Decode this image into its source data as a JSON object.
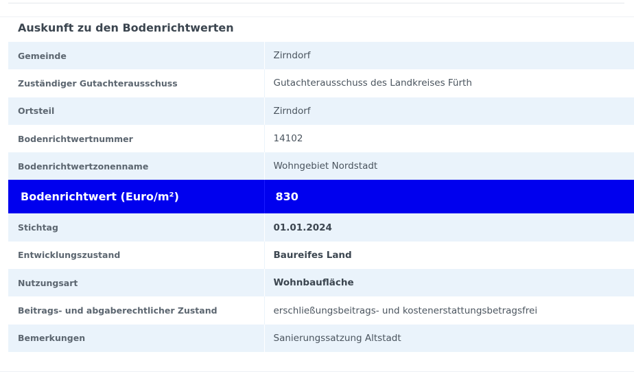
{
  "title": "Auskunft zu den Bodenrichtwerten",
  "rows_before": [
    {
      "label": "Gemeinde",
      "value": "Zirndorf"
    },
    {
      "label": "Zuständiger Gutachterausschuss",
      "value": "Gutachterausschuss des Landkreises Fürth"
    },
    {
      "label": "Ortsteil",
      "value": "Zirndorf"
    },
    {
      "label": "Bodenrichtwertnummer",
      "value": "14102"
    },
    {
      "label": "Bodenrichtwertzonenname",
      "value": "Wohngebiet Nordstadt"
    }
  ],
  "highlight": {
    "label": "Bodenrichtwert (Euro/m²)",
    "value": "830",
    "color": "#0000ee"
  },
  "rows_after": [
    {
      "label": "Stichtag",
      "value": "01.01.2024"
    },
    {
      "label": "Entwicklungszustand",
      "value": "Baureifes Land"
    },
    {
      "label": "Nutzungsart",
      "value": "Wohnbaufläche"
    },
    {
      "label": "Beitrags- und abgaberechtlicher Zustand",
      "value": "erschließungsbeitrags- und kostenerstattungsbetragsfrei"
    },
    {
      "label": "Bemerkungen",
      "value": "Sanierungssatzung Altstadt"
    }
  ]
}
